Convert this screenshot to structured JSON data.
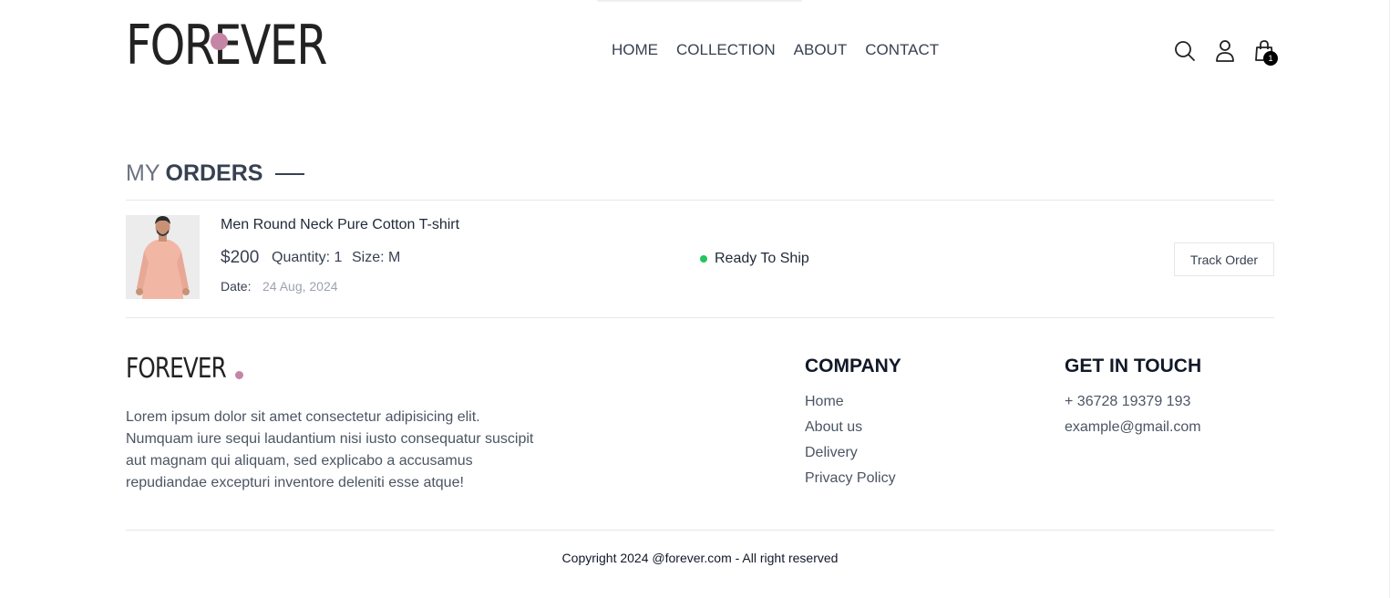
{
  "header": {
    "logo": "FOREVER",
    "nav": [
      "HOME",
      "COLLECTION",
      "ABOUT",
      "CONTACT"
    ],
    "icons": {
      "search": "search-icon",
      "profile": "user-icon",
      "cart": "shopping-bag-icon"
    },
    "cart_count": "1"
  },
  "orders": {
    "title_light": "MY",
    "title_bold": "ORDERS",
    "items": [
      {
        "name": "Men Round Neck Pure Cotton T-shirt",
        "price": "$200",
        "quantity": "Quantity: 1",
        "size": "Size: M",
        "date_label": "Date:",
        "date_value": "24 Aug, 2024",
        "status": "Ready To Ship",
        "action": "Track Order"
      }
    ]
  },
  "footer": {
    "logo": "FOREVER",
    "description": "Lorem ipsum dolor sit amet consectetur adipisicing elit. Numquam iure sequi laudantium nisi iusto consequatur suscipit aut magnam qui aliquam, sed explicabo a accusamus repudiandae excepturi inventore deleniti esse atque!",
    "company_title": "COMPANY",
    "company_links": [
      "Home",
      "About us",
      "Delivery",
      "Privacy Policy"
    ],
    "touch_title": "GET IN TOUCH",
    "touch_items": [
      "+ 36728 19379 193",
      "example@gmail.com"
    ],
    "copyright": "Copyright 2024 @forever.com - All right reserved"
  },
  "colors": {
    "accent_dot": "#c586a5",
    "status_green": "#22c55e",
    "text": "#374151"
  }
}
